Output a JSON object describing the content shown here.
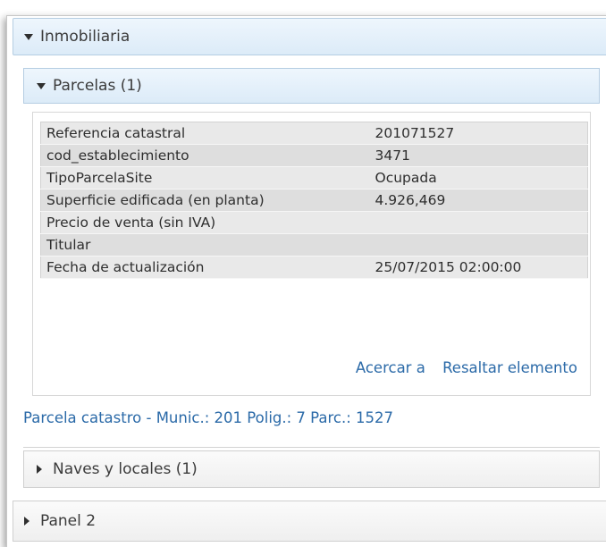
{
  "panels": {
    "inmobiliaria": {
      "label": "Inmobiliaria",
      "expanded": true
    },
    "panel2": {
      "label": "Panel 2",
      "expanded": false
    }
  },
  "layers": {
    "parcelas": {
      "label": "Parcelas (1)",
      "expanded": true
    },
    "naves": {
      "label": "Naves y locales (1)",
      "expanded": false
    }
  },
  "attributes": [
    {
      "key": "Referencia catastral",
      "value": "201071527"
    },
    {
      "key": "cod_establecimiento",
      "value": "3471"
    },
    {
      "key": "TipoParcelaSite",
      "value": "Ocupada"
    },
    {
      "key": "Superficie edificada (en planta)",
      "value": "4.926,469"
    },
    {
      "key": "Precio de venta (sin IVA)",
      "value": ""
    },
    {
      "key": "Titular",
      "value": ""
    },
    {
      "key": "Fecha de actualización",
      "value": "25/07/2015 02:00:00"
    }
  ],
  "actions": {
    "zoom_to": "Acercar a",
    "highlight": "Resaltar elemento"
  },
  "feature_title": "Parcela catastro - Munic.: 201 Polig.: 7 Parc.: 1527",
  "icons": {
    "expanded": "triangle-down-icon",
    "collapsed": "triangle-right-icon"
  }
}
